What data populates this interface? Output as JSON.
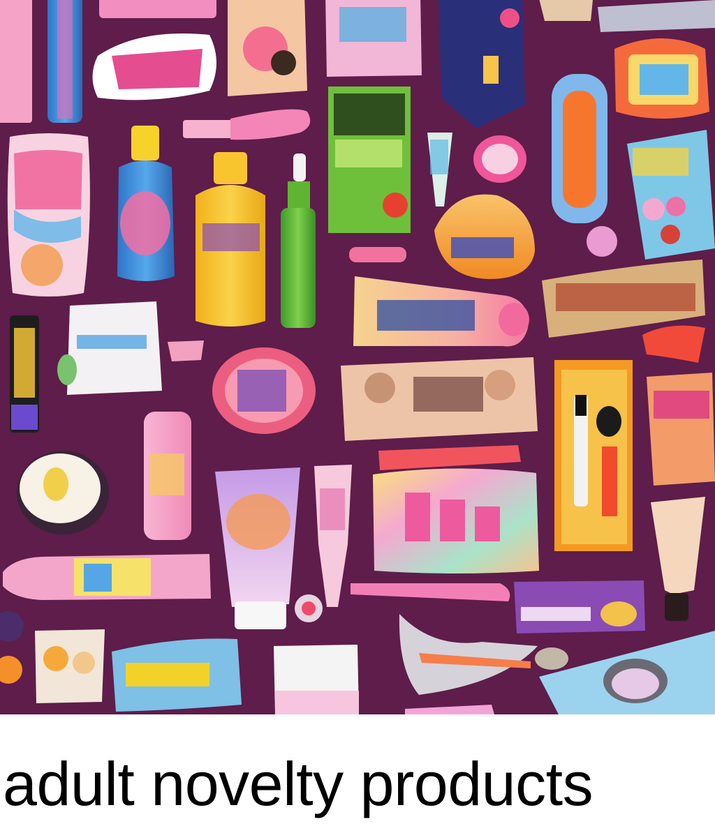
{
  "caption": "adult novelty products",
  "photo": {
    "description_icon": "product-collage-image",
    "colors": {
      "background": "#5e1d4a",
      "pink": "#f29ac6",
      "hot_pink": "#ee4f86",
      "yellow": "#f6c42a",
      "blue": "#3f8fd8",
      "green": "#5fb531",
      "orange": "#f4a23a",
      "purple": "#8a4bb5"
    }
  }
}
